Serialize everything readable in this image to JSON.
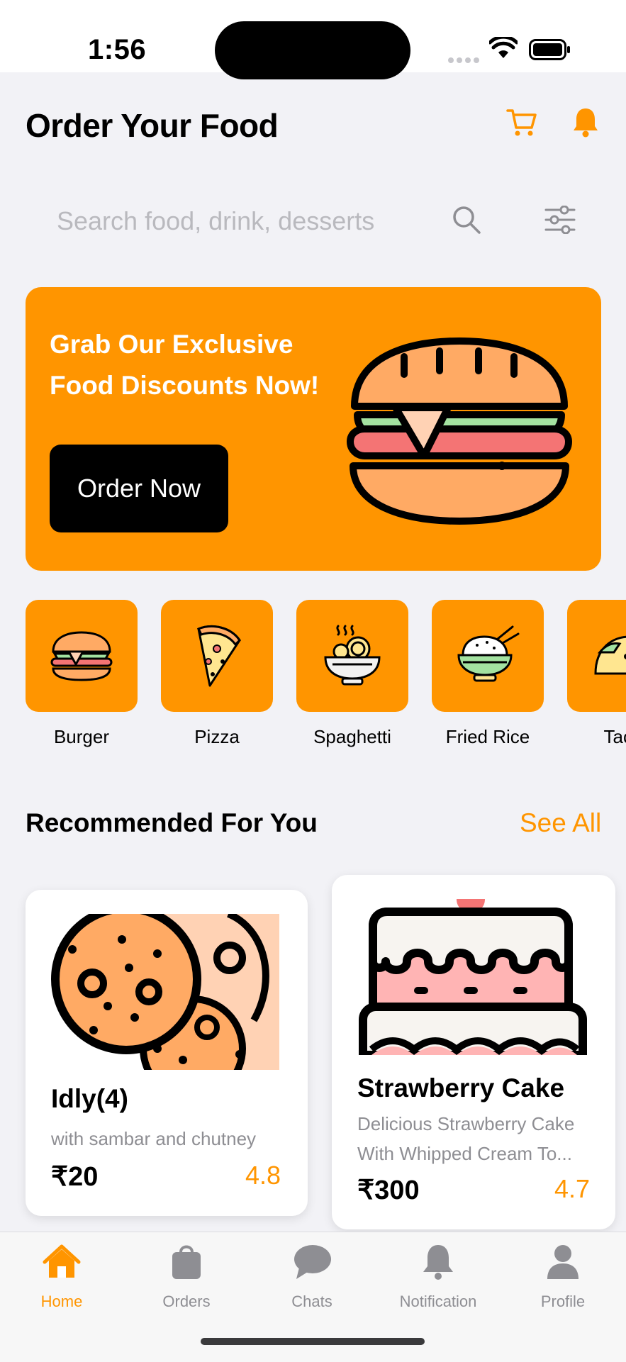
{
  "status_bar": {
    "time": "1:56"
  },
  "header": {
    "title": "Order Your Food"
  },
  "search": {
    "placeholder": "Search food, drink, desserts"
  },
  "banner": {
    "title_line1": "Grab Our Exclusive",
    "title_line2": "Food Discounts Now!",
    "button_label": "Order Now"
  },
  "categories": [
    {
      "label": "Burger",
      "icon": "burger-icon"
    },
    {
      "label": "Pizza",
      "icon": "pizza-icon"
    },
    {
      "label": "Spaghetti",
      "icon": "spaghetti-icon"
    },
    {
      "label": "Fried Rice",
      "icon": "fried-rice-icon"
    },
    {
      "label": "Taco",
      "icon": "taco-icon"
    }
  ],
  "recommended": {
    "title": "Recommended For You",
    "see_all": "See All",
    "items": [
      {
        "name": "Idly(4)",
        "description": "with sambar and chutney",
        "price": "₹20",
        "rating": "4.8"
      },
      {
        "name": "Strawberry Cake",
        "description_line1": "Delicious Strawberry Cake",
        "description_line2": "With Whipped Cream To...",
        "price": "₹300",
        "rating": "4.7"
      }
    ]
  },
  "tab_bar": {
    "tabs": [
      {
        "label": "Home",
        "icon": "home-icon",
        "active": true
      },
      {
        "label": "Orders",
        "icon": "bag-icon",
        "active": false
      },
      {
        "label": "Chats",
        "icon": "chat-bubble-icon",
        "active": false
      },
      {
        "label": "Notification",
        "icon": "bell-icon",
        "active": false
      },
      {
        "label": "Profile",
        "icon": "person-icon",
        "active": false
      }
    ]
  },
  "colors": {
    "accent": "#FF9500",
    "background": "#F2F2F6",
    "button_dark": "#000000"
  }
}
